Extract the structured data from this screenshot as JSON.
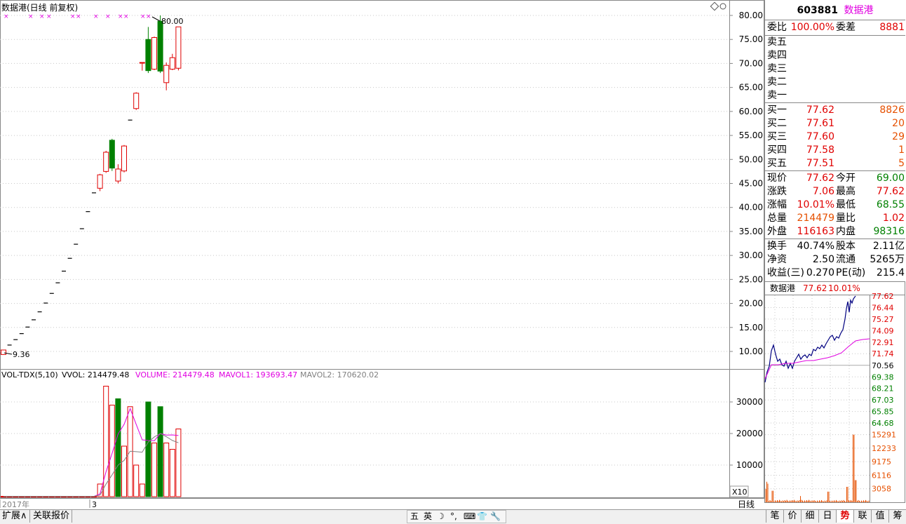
{
  "kchart": {
    "title": "数据港(日线 前复权)",
    "high_label": "80.00",
    "low_label": "9.36",
    "price_axis": [
      "80.00",
      "75.00",
      "70.00",
      "65.00",
      "60.00",
      "55.00",
      "50.00",
      "45.00",
      "40.00",
      "35.00",
      "30.00",
      "25.00",
      "20.00",
      "15.00",
      "10.00"
    ],
    "year_label": "2017年",
    "month_label": "3",
    "period_label": "日线",
    "corner_icon": "diamond-icon"
  },
  "volume": {
    "indicator": "VOL-TDX(5,10)",
    "vvol": "VVOL: 214479.48",
    "volume": "VOLUME: 214479.48",
    "mavol1": "MAVOL1: 193693.47",
    "mavol2": "MAVOL2: 170620.02",
    "axis": [
      "30000",
      "20000",
      "10000"
    ],
    "unit": "X10"
  },
  "chart_data": [
    {
      "type": "candlestick",
      "title": "数据港(日线 前复权)",
      "ylim": [
        9.36,
        80.0
      ],
      "candles": [
        {
          "open": 9.36,
          "close": 10.3,
          "high": 10.3,
          "low": 9.36
        },
        {
          "open": 11.33,
          "close": 11.33,
          "high": 11.33,
          "low": 11.33
        },
        {
          "open": 12.46,
          "close": 12.46,
          "high": 12.46,
          "low": 12.46
        },
        {
          "open": 13.71,
          "close": 13.71,
          "high": 13.71,
          "low": 13.71
        },
        {
          "open": 15.08,
          "close": 15.08,
          "high": 15.08,
          "low": 15.08
        },
        {
          "open": 16.59,
          "close": 16.59,
          "high": 16.59,
          "low": 16.59
        },
        {
          "open": 18.25,
          "close": 18.25,
          "high": 18.25,
          "low": 18.25
        },
        {
          "open": 20.08,
          "close": 20.08,
          "high": 20.08,
          "low": 20.08
        },
        {
          "open": 22.09,
          "close": 22.09,
          "high": 22.09,
          "low": 22.09
        },
        {
          "open": 24.3,
          "close": 24.3,
          "high": 24.3,
          "low": 24.3
        },
        {
          "open": 26.73,
          "close": 26.73,
          "high": 26.73,
          "low": 26.73
        },
        {
          "open": 29.4,
          "close": 29.4,
          "high": 29.4,
          "low": 29.4
        },
        {
          "open": 32.34,
          "close": 32.34,
          "high": 32.34,
          "low": 32.34
        },
        {
          "open": 35.57,
          "close": 35.57,
          "high": 35.57,
          "low": 35.57
        },
        {
          "open": 39.13,
          "close": 39.13,
          "high": 39.13,
          "low": 39.13
        },
        {
          "open": 43.04,
          "close": 43.04,
          "high": 43.04,
          "low": 43.04
        },
        {
          "open": 44.0,
          "close": 46.8,
          "high": 47.0,
          "low": 43.4
        },
        {
          "open": 47.5,
          "close": 51.5,
          "high": 51.8,
          "low": 47.2
        },
        {
          "open": 54.0,
          "close": 48.2,
          "high": 54.3,
          "low": 47.6
        },
        {
          "open": 45.5,
          "close": 48.0,
          "high": 49.0,
          "low": 45.0
        },
        {
          "open": 47.6,
          "close": 52.8,
          "high": 53.0,
          "low": 47.3
        },
        {
          "open": 58.2,
          "close": 58.2,
          "high": 58.2,
          "low": 58.2
        },
        {
          "open": 60.6,
          "close": 63.8,
          "high": 64.0,
          "low": 60.3
        },
        {
          "open": 70.2,
          "close": 70.2,
          "high": 70.2,
          "low": 68.5
        },
        {
          "open": 75.0,
          "close": 68.5,
          "high": 77.6,
          "low": 68.0
        },
        {
          "open": 68.8,
          "close": 75.4,
          "high": 75.6,
          "low": 68.6
        },
        {
          "open": 78.8,
          "close": 68.4,
          "high": 80.0,
          "low": 68.0
        },
        {
          "open": 66.0,
          "close": 69.6,
          "high": 70.2,
          "low": 64.4
        },
        {
          "open": 68.8,
          "close": 71.2,
          "high": 72.0,
          "low": 68.6
        },
        {
          "open": 69.0,
          "close": 77.62,
          "high": 77.62,
          "low": 68.55
        }
      ]
    },
    {
      "type": "bar",
      "title": "VOL-TDX(5,10)",
      "ylabel": "X10",
      "ylim": [
        0,
        36000
      ],
      "values": [
        100,
        100,
        100,
        100,
        100,
        100,
        100,
        100,
        100,
        100,
        100,
        100,
        100,
        100,
        100,
        100,
        4000,
        35000,
        29000,
        31000,
        16000,
        28500,
        10000,
        4000,
        30000,
        17000,
        28500,
        17000,
        15000,
        21448
      ],
      "colors": [
        "r",
        "r",
        "r",
        "r",
        "r",
        "r",
        "r",
        "r",
        "r",
        "r",
        "r",
        "r",
        "r",
        "r",
        "r",
        "r",
        "r",
        "r",
        "r",
        "g",
        "r",
        "r",
        "r",
        "r",
        "g",
        "r",
        "g",
        "r",
        "r",
        "r"
      ],
      "mavol1": [
        100,
        100,
        100,
        100,
        100,
        100,
        100,
        100,
        100,
        100,
        100,
        100,
        100,
        100,
        100,
        100,
        880,
        7880,
        13660,
        19840,
        22900,
        27900,
        22900,
        18000,
        17800,
        17700,
        20000,
        19500,
        19560,
        19369
      ],
      "mavol2": [
        100,
        100,
        100,
        100,
        100,
        100,
        100,
        100,
        100,
        100,
        100,
        100,
        100,
        100,
        100,
        100,
        490,
        3990,
        6880,
        9970,
        11500,
        14390,
        14250,
        14090,
        17290,
        18900,
        20000,
        19000,
        17800,
        17062
      ]
    }
  ],
  "quote": {
    "code": "603881",
    "name": "数据港",
    "weibi_label": "委比",
    "weibi": "100.00%",
    "weicha_label": "委差",
    "weicha": "8881",
    "sells": [
      {
        "label": "卖五"
      },
      {
        "label": "卖四"
      },
      {
        "label": "卖三"
      },
      {
        "label": "卖二"
      },
      {
        "label": "卖一"
      }
    ],
    "buys": [
      {
        "label": "买一",
        "price": "77.62",
        "vol": "8826"
      },
      {
        "label": "买二",
        "price": "77.61",
        "vol": "20"
      },
      {
        "label": "买三",
        "price": "77.60",
        "vol": "29"
      },
      {
        "label": "买四",
        "price": "77.58",
        "vol": "1"
      },
      {
        "label": "买五",
        "price": "77.51",
        "vol": "5"
      }
    ],
    "stats": [
      {
        "l1": "现价",
        "v1": "77.62",
        "c1": "red",
        "l2": "今开",
        "v2": "69.00",
        "c2": "green"
      },
      {
        "l1": "涨跌",
        "v1": "7.06",
        "c1": "red",
        "l2": "最高",
        "v2": "77.62",
        "c2": "red"
      },
      {
        "l1": "涨幅",
        "v1": "10.01%",
        "c1": "red",
        "l2": "最低",
        "v2": "68.55",
        "c2": "green"
      },
      {
        "l1": "总量",
        "v1": "214479",
        "c1": "orange",
        "l2": "量比",
        "v2": "1.02",
        "c2": "red"
      },
      {
        "l1": "外盘",
        "v1": "116163",
        "c1": "red",
        "l2": "内盘",
        "v2": "98316",
        "c2": "green"
      }
    ],
    "fund": [
      {
        "l1": "换手",
        "v1": "40.74%",
        "l2": "股本",
        "v2": "2.11亿"
      },
      {
        "l1": "净资",
        "v1": "2.50",
        "l2": "流通",
        "v2": "5265万"
      },
      {
        "l1": "收益(三)",
        "v1": "0.270",
        "l2": "PE(动)",
        "v2": "215.4"
      }
    ]
  },
  "mini": {
    "name": "数据港",
    "price": "77.62",
    "pct": "10.01%",
    "price_axis": [
      "77.62",
      "76.44",
      "75.27",
      "74.09",
      "72.91",
      "71.74",
      "70.56",
      "69.38",
      "68.21",
      "67.03",
      "65.85",
      "64.68"
    ],
    "vol_axis": [
      "15291",
      "12233",
      "9175",
      "6116",
      "3058"
    ]
  },
  "bottom": {
    "left_tabs": [
      "扩展∧",
      "关联报价"
    ],
    "right_tabs": [
      "笔",
      "价",
      "细",
      "日",
      "势",
      "联",
      "值",
      "筹"
    ],
    "active_right": 4,
    "ime": [
      "五",
      "英",
      "☽",
      "°,",
      "⌨",
      "👕",
      "🔧"
    ]
  }
}
